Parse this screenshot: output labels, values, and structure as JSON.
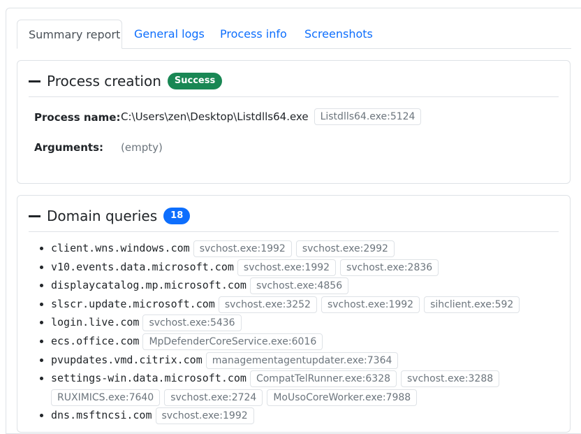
{
  "tabs": [
    {
      "label": "Summary report",
      "active": true
    },
    {
      "label": "General logs",
      "active": false
    },
    {
      "label": "Process info",
      "active": false
    },
    {
      "label": "Screenshots",
      "active": false
    }
  ],
  "process_creation": {
    "title": "Process creation",
    "status": "Success",
    "status_color": "#198754",
    "process_name_label": "Process name:",
    "process_name_value": "C:\\Users\\zen\\Desktop\\Listdlls64.exe",
    "process_tag": "Listdlls64.exe:5124",
    "arguments_label": "Arguments:",
    "arguments_value": "(empty)"
  },
  "domain_queries": {
    "title": "Domain queries",
    "count": "18",
    "count_color": "#0d6efd",
    "items": [
      {
        "domain": "client.wns.windows.com",
        "processes": [
          "svchost.exe:1992",
          "svchost.exe:2992"
        ]
      },
      {
        "domain": "v10.events.data.microsoft.com",
        "processes": [
          "svchost.exe:1992",
          "svchost.exe:2836"
        ]
      },
      {
        "domain": "displaycatalog.mp.microsoft.com",
        "processes": [
          "svchost.exe:4856"
        ]
      },
      {
        "domain": "slscr.update.microsoft.com",
        "processes": [
          "svchost.exe:3252",
          "svchost.exe:1992",
          "sihclient.exe:592"
        ]
      },
      {
        "domain": "login.live.com",
        "processes": [
          "svchost.exe:5436"
        ]
      },
      {
        "domain": "ecs.office.com",
        "processes": [
          "MpDefenderCoreService.exe:6016"
        ]
      },
      {
        "domain": "pvupdates.vmd.citrix.com",
        "processes": [
          "managementagentupdater.exe:7364"
        ]
      },
      {
        "domain": "settings-win.data.microsoft.com",
        "processes": [
          "CompatTelRunner.exe:6328",
          "svchost.exe:3288",
          "RUXIMICS.exe:7640",
          "svchost.exe:2724",
          "MoUsoCoreWorker.exe:7988"
        ]
      },
      {
        "domain": "dns.msftncsi.com",
        "processes": [
          "svchost.exe:1992"
        ]
      }
    ]
  }
}
